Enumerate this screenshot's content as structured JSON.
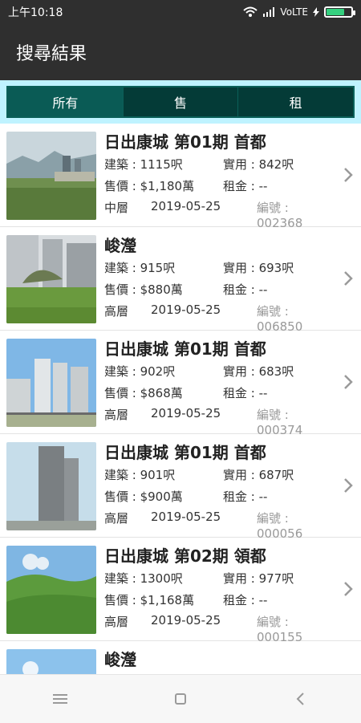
{
  "status_bar": {
    "time": "上午10:18",
    "network": "VoLTE",
    "battery_level": 0.8
  },
  "app_bar": {
    "title": "搜尋結果"
  },
  "tabs": [
    {
      "label": "所有",
      "active": true
    },
    {
      "label": "售",
      "active": false
    },
    {
      "label": "租",
      "active": false
    }
  ],
  "labels": {
    "building_prefix": "建築 : ",
    "usable_prefix": "實用 : ",
    "sale_prefix": "售價 : ",
    "rent_prefix": "租金 : ",
    "code_prefix": "編號 : "
  },
  "listings": [
    {
      "title": "日出康城 第01期 首都",
      "building_area": "1115呎",
      "usable_area": "842呎",
      "sale_price": "$1,180萬",
      "rent": "--",
      "floor": "中層",
      "date": "2019-05-25",
      "code": "002368"
    },
    {
      "title": "峻瀅",
      "building_area": "915呎",
      "usable_area": "693呎",
      "sale_price": "$880萬",
      "rent": "--",
      "floor": "高層",
      "date": "2019-05-25",
      "code": "006850"
    },
    {
      "title": "日出康城 第01期 首都",
      "building_area": "902呎",
      "usable_area": "683呎",
      "sale_price": "$868萬",
      "rent": "--",
      "floor": "高層",
      "date": "2019-05-25",
      "code": "000374"
    },
    {
      "title": "日出康城 第01期 首都",
      "building_area": "901呎",
      "usable_area": "687呎",
      "sale_price": "$900萬",
      "rent": "--",
      "floor": "高層",
      "date": "2019-05-25",
      "code": "000056"
    },
    {
      "title": "日出康城 第02期 領都",
      "building_area": "1300呎",
      "usable_area": "977呎",
      "sale_price": "$1,168萬",
      "rent": "--",
      "floor": "高層",
      "date": "2019-05-25",
      "code": "000155"
    },
    {
      "title": "峻瀅"
    }
  ],
  "icons": {
    "chevron": "chevron-right-icon",
    "menu": "menu-icon",
    "home": "home-icon",
    "back": "back-icon"
  },
  "colors": {
    "tab_bg": "#043b37",
    "tab_active": "#0a5b55",
    "tab_wrap": "#bff3ff",
    "header": "#2f2f2f"
  }
}
